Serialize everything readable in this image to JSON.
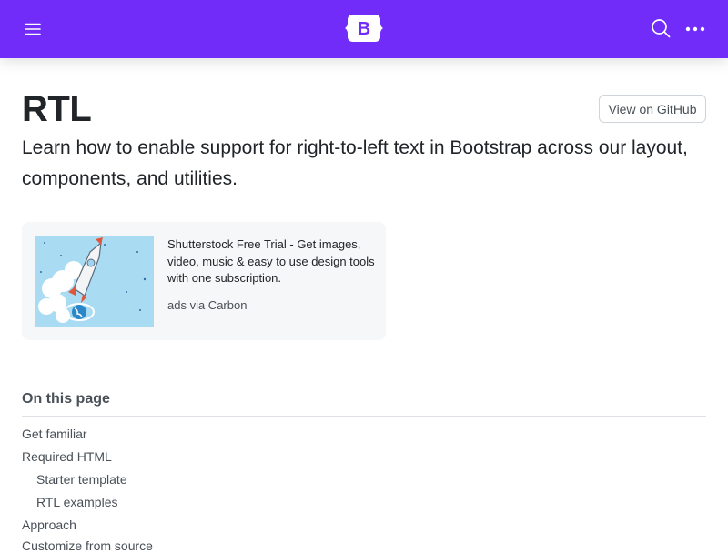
{
  "navbar": {
    "logo_letter": "B",
    "brand_color": "#712cf9",
    "icons": [
      "hamburger-icon",
      "bootstrap-logo",
      "search-icon",
      "more-icon"
    ]
  },
  "header": {
    "title": "RTL",
    "github_button": "View on GitHub",
    "lead": "Learn how to enable support for right-to-left text in Bootstrap across our layout, components, and utilities."
  },
  "ad": {
    "text": "Shutterstock Free Trial - Get images, video, music & easy to use design tools with one subscription.",
    "via": "ads via Carbon"
  },
  "toc": {
    "title": "On this page",
    "items": [
      {
        "label": "Get familiar"
      },
      {
        "label": "Required HTML"
      },
      {
        "label": "Starter template"
      },
      {
        "label": "RTL examples"
      },
      {
        "label": "Approach"
      },
      {
        "label": "Customize from source"
      }
    ]
  }
}
